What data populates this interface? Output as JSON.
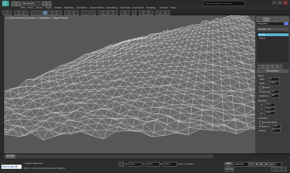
{
  "window": {
    "workspace": "Workspace: Default",
    "search_placeholder": "Type a keyword or phrase",
    "controls": [
      "—",
      "□",
      "✕"
    ]
  },
  "menu": [
    "Edit",
    "Tools",
    "Group",
    "Views",
    "Create",
    "Modifiers",
    "Animation",
    "Graph Editors",
    "Rendering",
    "Civil View",
    "Customize",
    "Scripting",
    "Content",
    "Help"
  ],
  "viewport": {
    "label": "[+] [Perspective] [Smooth + Highlights + Edged Faces]",
    "bg": "#575757",
    "mesh_color": "#d9d9d9"
  },
  "command_panel": {
    "object_name": "Plane001",
    "object_color": "#6b7fff",
    "modifier_list": "Modifier List",
    "stack": [
      "Noise",
      "Plane"
    ],
    "selected_index": 0,
    "rollout_title": "Parameters",
    "noise_label": "Noise:",
    "seed": {
      "label": "Seed:",
      "value": "0"
    },
    "scale": {
      "label": "Scale:",
      "value": "100.0"
    },
    "fractal": "Fractal",
    "roughness": {
      "label": "Roughness:",
      "value": "0.0"
    },
    "iterations": {
      "label": "Iterations:",
      "value": "6.0"
    },
    "strength_label": "Strength:",
    "x": {
      "label": "X:",
      "value": "0.0m"
    },
    "y": {
      "label": "Y:",
      "value": "0.0m"
    },
    "z": {
      "label": "Z:",
      "value": "2.0m"
    },
    "animation_label": "Animation:",
    "animate_noise": "Animate Noise",
    "frequency": {
      "label": "Frequency:",
      "value": "0.25"
    },
    "phase": {
      "label": "Phase:",
      "value": "0"
    }
  },
  "timeline": {
    "position": "0 / 100"
  },
  "status": {
    "maxscript": "MAXScript Mi",
    "objects_selected": "1 Object Selected",
    "prompt": "Click or click-and-drag to select objects",
    "x": "0.0m",
    "y": "0.0m",
    "z": "0.0m",
    "grid": "Grid = 0.254m",
    "autokey": "Auto Key",
    "selected": "Selected",
    "setkey": "Set Key",
    "frame": "0"
  }
}
